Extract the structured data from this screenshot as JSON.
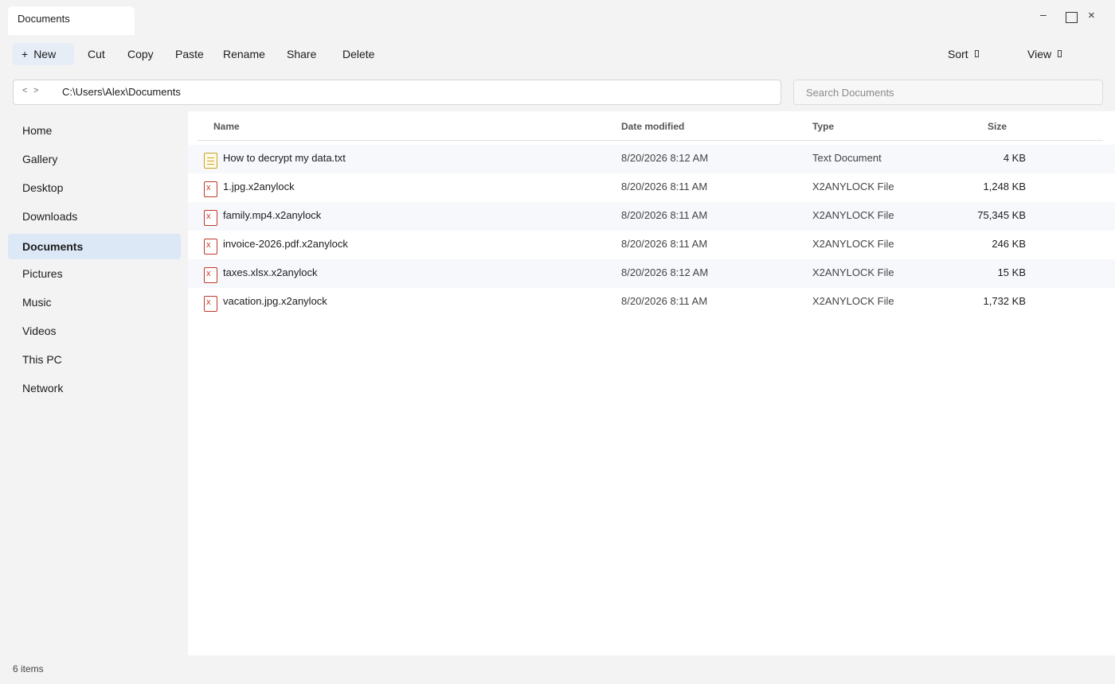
{
  "window": {
    "tab_title": "Documents",
    "controls": {
      "minimize": "–",
      "maximize": "",
      "close": "×"
    }
  },
  "toolbar": {
    "new_label": "New",
    "new_icon": "+",
    "cut_label": "Cut",
    "copy_label": "Copy",
    "paste_label": "Paste",
    "rename_label": "Rename",
    "share_label": "Share",
    "delete_label": "Delete",
    "sort_label": "Sort",
    "view_label": "View"
  },
  "address": {
    "back_icon": "<",
    "forward_icon": ">",
    "path": "C:\\Users\\Alex\\Documents"
  },
  "search": {
    "placeholder": "Search Documents",
    "value": ""
  },
  "sidebar": {
    "items": [
      {
        "label": "Home",
        "active": false
      },
      {
        "label": "Gallery",
        "active": false
      },
      {
        "label": "Desktop",
        "active": false
      },
      {
        "label": "Downloads",
        "active": false
      },
      {
        "label": "Documents",
        "active": true
      },
      {
        "label": "Pictures",
        "active": false
      },
      {
        "label": "Music",
        "active": false
      },
      {
        "label": "Videos",
        "active": false
      },
      {
        "label": "This PC",
        "active": false
      },
      {
        "label": "Network",
        "active": false
      }
    ]
  },
  "files": {
    "columns": {
      "name": "Name",
      "date": "Date modified",
      "type": "Type",
      "size": "Size"
    },
    "rows": [
      {
        "name": "How to decrypt my data.txt",
        "date": "8/20/2026 8:12 AM",
        "type": "Text Document",
        "size": "4 KB",
        "icon": "text-file-icon"
      },
      {
        "name": "1.jpg.x2anylock",
        "date": "8/20/2026 8:11 AM",
        "type": "X2ANYLOCK File",
        "size": "1,248 KB",
        "icon": "locked-file-icon"
      },
      {
        "name": "family.mp4.x2anylock",
        "date": "8/20/2026 8:11 AM",
        "type": "X2ANYLOCK File",
        "size": "75,345 KB",
        "icon": "locked-file-icon"
      },
      {
        "name": "invoice-2026.pdf.x2anylock",
        "date": "8/20/2026 8:11 AM",
        "type": "X2ANYLOCK File",
        "size": "246 KB",
        "icon": "locked-file-icon"
      },
      {
        "name": "taxes.xlsx.x2anylock",
        "date": "8/20/2026 8:12 AM",
        "type": "X2ANYLOCK File",
        "size": "15 KB",
        "icon": "locked-file-icon"
      },
      {
        "name": "vacation.jpg.x2anylock",
        "date": "8/20/2026 8:11 AM",
        "type": "X2ANYLOCK File",
        "size": "1,732 KB",
        "icon": "locked-file-icon"
      }
    ],
    "locked_icon_glyph": "x"
  },
  "status": {
    "item_count": "6 items"
  },
  "colors": {
    "accent_selected": "#dde8f6",
    "locked_icon": "#c0392b",
    "text_icon": "#c9a227"
  }
}
